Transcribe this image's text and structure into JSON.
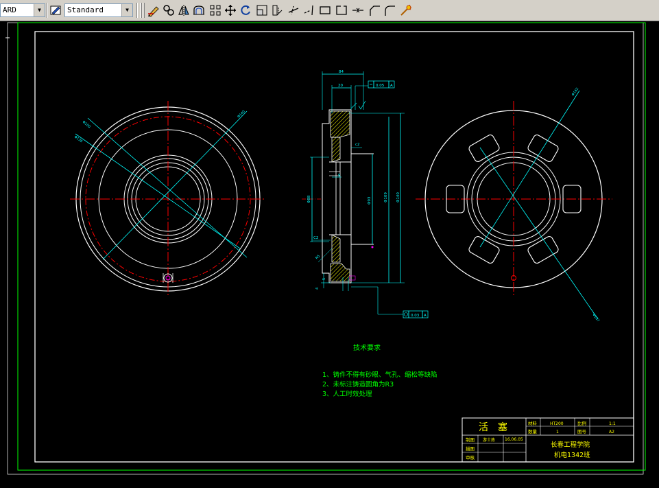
{
  "toolbar": {
    "layer_combo_value": "ARD",
    "text_style_combo_value": "Standard",
    "icons": [
      "text-style-icon",
      "pencil-icon",
      "linked-circles-icon",
      "mirror-icon",
      "offset-icon",
      "array-icon",
      "move-icon",
      "rotate-icon",
      "scale-icon",
      "stretch-icon",
      "trim-icon",
      "extend-icon",
      "break-icon",
      "rectangle-break-icon",
      "join-icon",
      "chamfer-icon",
      "fillet-icon",
      "explode-icon"
    ]
  },
  "colors": {
    "background": "#000000",
    "outline": "#ffffff",
    "dimension": "#00ffff",
    "center_line": "#ff0000",
    "hatch": "#ffff00",
    "text_green": "#00ff00",
    "title_text": "#ffff00",
    "frame": "#ffffff",
    "border": "#00ff00"
  },
  "drawing": {
    "tech_title": "技术要求",
    "tech_items": [
      "1、铸件不得有砂眼、气孔、缩松等缺陷",
      "2、未标注铸造圆角为R3",
      "3、人工时效处理"
    ],
    "dims": {
      "d84": "84",
      "d20": "20",
      "d9": "9",
      "tol1": "0.05",
      "tol2": "0.03",
      "ref_a": "A",
      "c2": "c2",
      "c2b": "C2",
      "d_left1": "Φ100",
      "d_left2": "Φ136",
      "d_left3": "Φ140",
      "d_mid1": "Φ88",
      "d_mid2": "Φ93",
      "d_mid3": "Φ109",
      "d_mid4": "Φ140",
      "d_right1": "Φ162",
      "d_right2": "Φ157",
      "r5": "R5",
      "s5": "5",
      "s4": "4"
    },
    "title_block": {
      "part_name": "活塞",
      "material_label": "材料",
      "material_value": "HT200",
      "scale_label": "比例",
      "scale_value": "1:1",
      "qty_label": "数量",
      "qty_value": "1",
      "drawing_no_label": "图号",
      "drawing_no_value": "A2",
      "drawn_label": "制图",
      "drawn_name": "游士炼",
      "drawn_date": "16.06.05",
      "design_label": "描图",
      "check_label": "审核",
      "school": "长春工程学院",
      "class_name": "机电1342班"
    }
  }
}
